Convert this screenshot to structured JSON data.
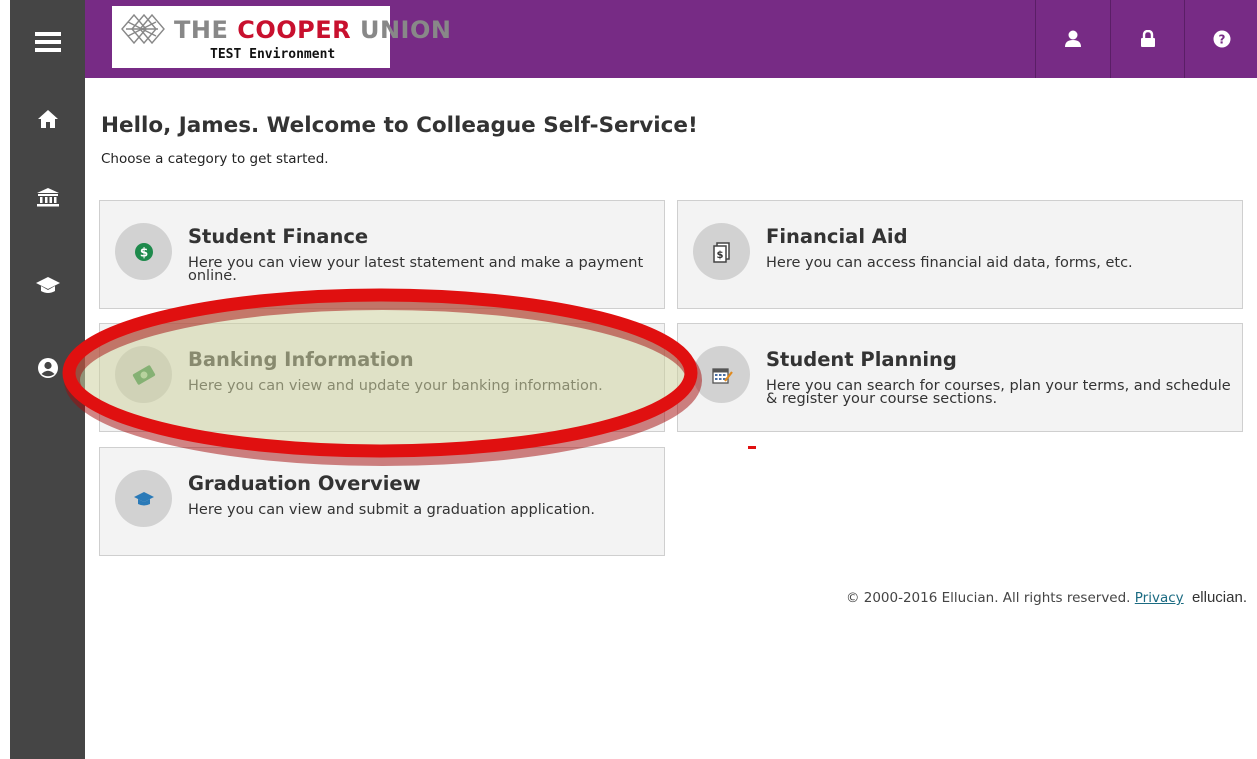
{
  "header": {
    "logo_title_plain": "THE ",
    "logo_title_red": "COOPER",
    "logo_title_rest": " UNION",
    "logo_sub": "TEST Environment",
    "buttons": [
      "user-icon",
      "lock-icon",
      "help-icon"
    ],
    "color": "#772b85"
  },
  "sidebar": {
    "items": [
      "menu-icon",
      "home-icon",
      "bank-icon",
      "graduation-cap-icon",
      "user-circle-icon"
    ],
    "color": "#454545"
  },
  "main": {
    "welcome": "Hello, James. Welcome to Colleague Self-Service!",
    "subtitle": "Choose a category to get started.",
    "tiles": [
      {
        "title": "Student Finance",
        "desc": "Here you can view your latest statement and make a payment online.",
        "icon": "dollar-coin-icon"
      },
      {
        "title": "Financial Aid",
        "desc": "Here you can access financial aid data, forms, etc.",
        "icon": "dollar-document-icon"
      },
      {
        "title": "Banking Information",
        "desc": "Here you can view and update your banking information.",
        "icon": "money-bill-icon"
      },
      {
        "title": "Student Planning",
        "desc": "Here you can search for courses, plan your terms, and schedule & register your course sections.",
        "icon": "calendar-icon"
      },
      {
        "title": "Graduation Overview",
        "desc": "Here you can view and submit a graduation application.",
        "icon": "graduation-cap-icon"
      }
    ]
  },
  "footer": {
    "copyright": "© 2000-2016 Ellucian. All rights reserved.",
    "privacy": "Privacy",
    "brand": "ellucian."
  },
  "annotation": {
    "highlight_color": "#e01010"
  }
}
